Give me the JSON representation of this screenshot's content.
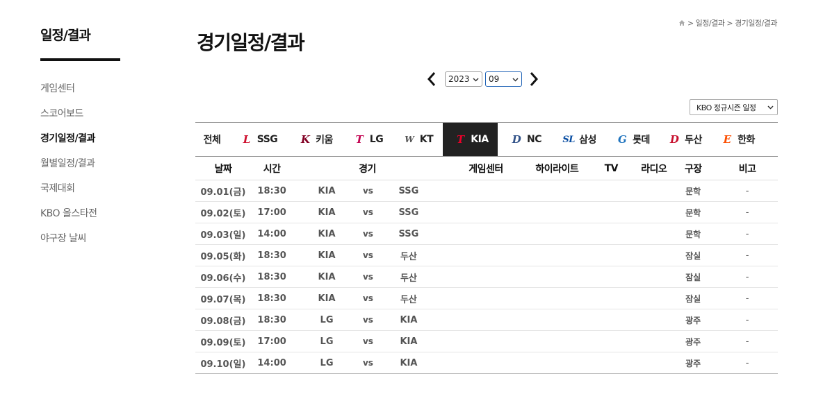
{
  "sidebar": {
    "title": "일정/결과",
    "items": [
      {
        "label": "게임센터",
        "active": false
      },
      {
        "label": "스코어보드",
        "active": false
      },
      {
        "label": "경기일정/결과",
        "active": true
      },
      {
        "label": "월별일정/결과",
        "active": false
      },
      {
        "label": "국제대회",
        "active": false
      },
      {
        "label": "KBO 올스타전",
        "active": false
      },
      {
        "label": "야구장 날씨",
        "active": false
      }
    ]
  },
  "breadcrumb": {
    "icon": "home-icon",
    "items": [
      "> 일정/결과",
      "> 경기일정/결과"
    ]
  },
  "page_title": "경기일정/결과",
  "date_selector": {
    "year": "2023",
    "month": "09"
  },
  "season_select": "KBO 정규시즌 일정",
  "teams": [
    {
      "label": "전체",
      "logo": "",
      "color": "#222",
      "active": false
    },
    {
      "label": "SSG",
      "logo": "L",
      "color": "#ce0e2d",
      "active": false
    },
    {
      "label": "키움",
      "logo": "K",
      "color": "#820024",
      "active": false
    },
    {
      "label": "LG",
      "logo": "T",
      "color": "#c30452",
      "active": false
    },
    {
      "label": "KT",
      "logo": "W",
      "color": "#555",
      "active": false
    },
    {
      "label": "KIA",
      "logo": "T",
      "color": "#ea0029",
      "active": true
    },
    {
      "label": "NC",
      "logo": "D",
      "color": "#315288",
      "active": false
    },
    {
      "label": "삼성",
      "logo": "SL",
      "color": "#074ca1",
      "active": false
    },
    {
      "label": "롯데",
      "logo": "G",
      "color": "#1e73be",
      "active": false
    },
    {
      "label": "두산",
      "logo": "D",
      "color": "#c8102e",
      "active": false
    },
    {
      "label": "한화",
      "logo": "E",
      "color": "#fc4e00",
      "active": false
    }
  ],
  "table": {
    "headers": {
      "date": "날짜",
      "time": "시간",
      "game": "경기",
      "center": "게임센터",
      "highlight": "하이라이트",
      "tv": "TV",
      "radio": "라디오",
      "stadium": "구장",
      "note": "비고"
    },
    "rows": [
      {
        "date": "09.01(금)",
        "time": "18:30",
        "away": "KIA",
        "vs": "vs",
        "home": "SSG",
        "stadium": "문학",
        "note": "-"
      },
      {
        "date": "09.02(토)",
        "time": "17:00",
        "away": "KIA",
        "vs": "vs",
        "home": "SSG",
        "stadium": "문학",
        "note": "-"
      },
      {
        "date": "09.03(일)",
        "time": "14:00",
        "away": "KIA",
        "vs": "vs",
        "home": "SSG",
        "stadium": "문학",
        "note": "-"
      },
      {
        "date": "09.05(화)",
        "time": "18:30",
        "away": "KIA",
        "vs": "vs",
        "home": "두산",
        "stadium": "잠실",
        "note": "-"
      },
      {
        "date": "09.06(수)",
        "time": "18:30",
        "away": "KIA",
        "vs": "vs",
        "home": "두산",
        "stadium": "잠실",
        "note": "-"
      },
      {
        "date": "09.07(목)",
        "time": "18:30",
        "away": "KIA",
        "vs": "vs",
        "home": "두산",
        "stadium": "잠실",
        "note": "-"
      },
      {
        "date": "09.08(금)",
        "time": "18:30",
        "away": "LG",
        "vs": "vs",
        "home": "KIA",
        "stadium": "광주",
        "note": "-"
      },
      {
        "date": "09.09(토)",
        "time": "17:00",
        "away": "LG",
        "vs": "vs",
        "home": "KIA",
        "stadium": "광주",
        "note": "-"
      },
      {
        "date": "09.10(일)",
        "time": "14:00",
        "away": "LG",
        "vs": "vs",
        "home": "KIA",
        "stadium": "광주",
        "note": "-"
      }
    ]
  }
}
